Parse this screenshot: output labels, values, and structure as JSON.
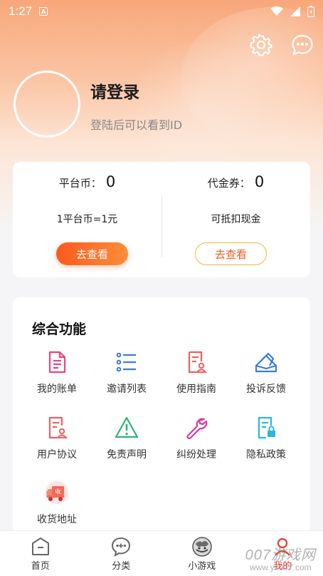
{
  "status": {
    "time": "1:27"
  },
  "profile": {
    "title": "请登录",
    "subtitle": "登陆后可以看到ID"
  },
  "wallet": {
    "left": {
      "label": "平台币：",
      "value": "0",
      "note": "1平台币=1元",
      "button": "去查看"
    },
    "right": {
      "label": "代金券：",
      "value": "0",
      "note": "可抵扣现金",
      "button": "去查看"
    }
  },
  "features": {
    "title": "综合功能",
    "items": [
      {
        "label": "我的账单",
        "icon": "bill-icon"
      },
      {
        "label": "邀请列表",
        "icon": "list-icon"
      },
      {
        "label": "使用指南",
        "icon": "guide-icon"
      },
      {
        "label": "投诉反馈",
        "icon": "feedback-icon"
      },
      {
        "label": "用户协议",
        "icon": "agreement-icon"
      },
      {
        "label": "免责声明",
        "icon": "warning-icon"
      },
      {
        "label": "纠纷处理",
        "icon": "wrench-icon"
      },
      {
        "label": "隐私政策",
        "icon": "privacy-icon"
      },
      {
        "label": "收货地址",
        "icon": "delivery-truck-icon",
        "badge": "收"
      }
    ]
  },
  "tabbar": [
    {
      "label": "首页",
      "icon": "home-icon"
    },
    {
      "label": "分类",
      "icon": "category-icon"
    },
    {
      "label": "小游戏",
      "icon": "mini-game-icon"
    },
    {
      "label": "我的",
      "icon": "profile-icon",
      "active": true
    }
  ],
  "watermark": {
    "text": "007游戏网",
    "sub": "www.yx007.com"
  },
  "colors": {
    "accent_orange": "#fb5a1e",
    "outline_yellow": "#f3b43a",
    "icon_pink": "#e8467c",
    "icon_blue": "#3a7ce0",
    "icon_red": "#f06060",
    "icon_green": "#2bb673",
    "icon_magenta": "#d63a9a",
    "icon_cyan": "#2bb7d8",
    "active_tab": "#e23a2c"
  }
}
